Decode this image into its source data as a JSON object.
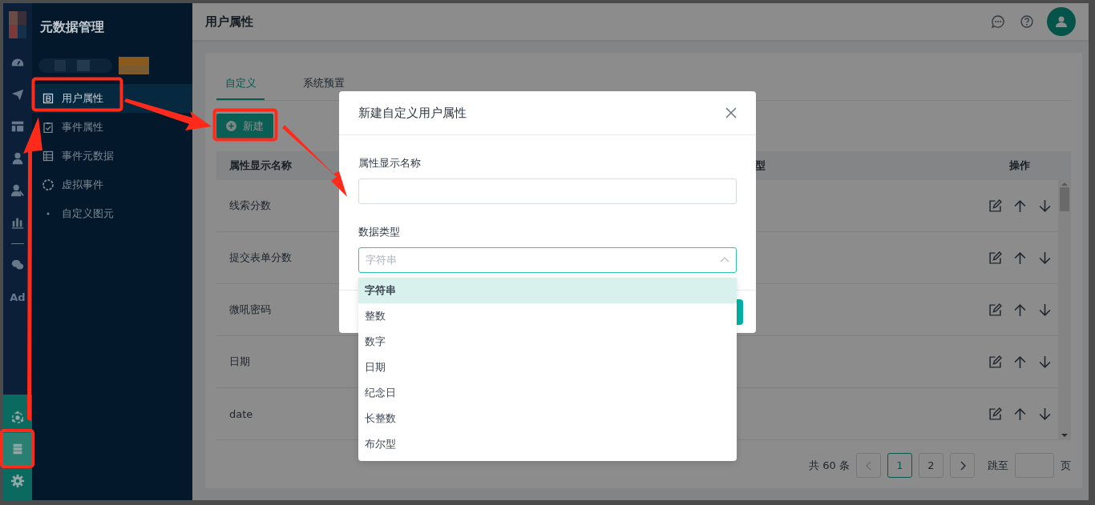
{
  "rail": {
    "items": [
      {
        "kind": "icon",
        "selected": false
      },
      {
        "kind": "icon",
        "selected": false
      },
      {
        "kind": "icon",
        "selected": false
      },
      {
        "kind": "icon",
        "selected": false
      },
      {
        "kind": "icon",
        "selected": false
      },
      {
        "kind": "icon",
        "selected": false
      },
      {
        "kind": "icon",
        "selected": false
      },
      {
        "kind": "text",
        "label": "Ad",
        "selected": false
      }
    ],
    "bottom_items": [
      {
        "kind": "icon",
        "selected": false
      },
      {
        "kind": "icon",
        "selected": true
      },
      {
        "kind": "icon",
        "selected": false
      }
    ]
  },
  "sidebar": {
    "title": "元数据管理",
    "items": [
      {
        "label": "用户属性",
        "selected": true
      },
      {
        "label": "事件属性",
        "selected": false
      },
      {
        "label": "事件元数据",
        "selected": false
      },
      {
        "label": "虚拟事件",
        "selected": false
      },
      {
        "label": "自定义图元",
        "selected": false
      }
    ]
  },
  "header": {
    "title": "用户属性"
  },
  "tabs": [
    {
      "label": "自定义",
      "selected": true
    },
    {
      "label": "系统预置",
      "selected": false
    }
  ],
  "new_button": {
    "label": "新建"
  },
  "table": {
    "columns": [
      "属性显示名称",
      "型",
      "操作"
    ],
    "rows": [
      {
        "name": "线索分数"
      },
      {
        "name": "提交表单分数"
      },
      {
        "name": "微吼密码"
      },
      {
        "name": "日期"
      },
      {
        "name": "date"
      }
    ]
  },
  "pagination": {
    "total": "共 60 条",
    "pages": [
      {
        "label": "1",
        "selected": true
      },
      {
        "label": "2",
        "selected": false
      }
    ],
    "jump_label": "跳至",
    "page_suffix": "页"
  },
  "modal": {
    "title": "新建自定义用户属性",
    "fields": [
      {
        "kind": "text",
        "label": "属性显示名称"
      },
      {
        "kind": "select",
        "label": "数据类型",
        "placeholder": "字符串",
        "expanded": true
      }
    ],
    "options": [
      {
        "label": "字符串",
        "selected": true
      },
      {
        "label": "整数",
        "selected": false
      },
      {
        "label": "数字",
        "selected": false
      },
      {
        "label": "日期",
        "selected": false
      },
      {
        "label": "纪念日",
        "selected": false
      },
      {
        "label": "长整数",
        "selected": false
      },
      {
        "label": "布尔型",
        "selected": false
      }
    ]
  }
}
